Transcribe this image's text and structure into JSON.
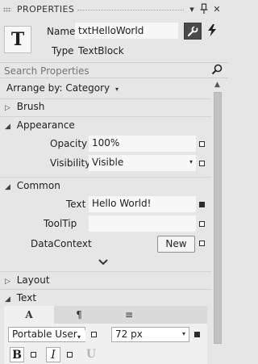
{
  "panel": {
    "title": "PROPERTIES",
    "controls": {
      "dropdown": "▾",
      "pin": "⊥",
      "close": "✕"
    }
  },
  "header": {
    "type_icon_letter": "T",
    "name_label": "Name",
    "name_value": "txtHelloWorld",
    "type_label": "Type",
    "type_value": "TextBlock",
    "properties_button_icon": "wrench-icon",
    "events_button_icon": "lightning-icon"
  },
  "search": {
    "placeholder": "Search Properties"
  },
  "arrange": {
    "label": "Arrange by: Category",
    "caret": "▾"
  },
  "categories": {
    "brush": {
      "label": "Brush",
      "expanded": false
    },
    "appearance": {
      "label": "Appearance",
      "expanded": true,
      "opacity": {
        "label": "Opacity",
        "value": "100%"
      },
      "visibility": {
        "label": "Visibility",
        "value": "Visible",
        "caret": "▾"
      }
    },
    "common": {
      "label": "Common",
      "expanded": true,
      "text": {
        "label": "Text",
        "value": "Hello World!"
      },
      "tooltip": {
        "label": "ToolTip",
        "value": ""
      },
      "datacontext": {
        "label": "DataContext",
        "button": "New"
      }
    },
    "layout": {
      "label": "Layout",
      "expanded": false
    },
    "text": {
      "label": "Text",
      "expanded": true,
      "tabs": [
        "A",
        "¶",
        "≡"
      ],
      "font_family": "Portable User Interface",
      "font_size": "72 px",
      "bold": "B",
      "italic": "I",
      "underline": "U"
    }
  },
  "colors": {
    "panel_bg": "#e6e6e6",
    "field_bg": "#f7f7f7",
    "active_button": "#4b4b4b"
  }
}
